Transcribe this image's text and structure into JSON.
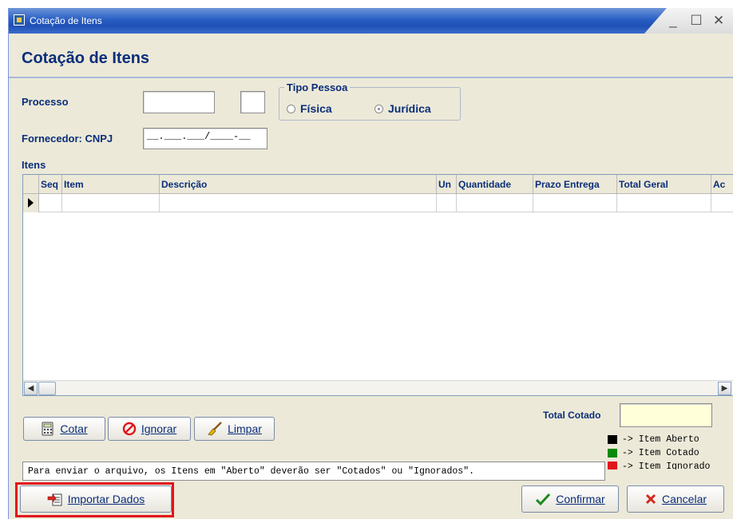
{
  "window": {
    "title": "Cotação de Itens",
    "minimize": "_",
    "maximize": "☐",
    "close": "✕"
  },
  "header": {
    "title": "Cotação de Itens"
  },
  "form": {
    "processo_label": "Processo",
    "processo_value": "",
    "processo_suffix_value": "",
    "fornecedor_label": "Fornecedor: CNPJ",
    "cnpj_mask": "__.___.___/____-__",
    "tipo_pessoa": {
      "legend": "Tipo Pessoa",
      "options": [
        "Física",
        "Jurídica"
      ],
      "selected": "Jurídica"
    }
  },
  "items": {
    "label": "Itens",
    "columns": [
      "Seq",
      "Item",
      "Descrição",
      "Un",
      "Quantidade",
      "Prazo Entrega",
      "Total Geral",
      "Ac"
    ],
    "rows": []
  },
  "total": {
    "label": "Total Cotado",
    "value": ""
  },
  "actions": {
    "cotar": "Cotar",
    "ignorar": "Ignorar",
    "limpar": "Limpar"
  },
  "note": "Para enviar o arquivo, os Itens em \"Aberto\" deverão ser \"Cotados\" ou \"Ignorados\".",
  "legend": [
    {
      "color": "#000000",
      "text": "-> Item Aberto"
    },
    {
      "color": "#0a8a0a",
      "text": "-> Item Cotado"
    },
    {
      "color": "#e2141c",
      "text": "-> Item Ignorado"
    }
  ],
  "footer": {
    "importar": "Importar Dados",
    "confirmar": "Confirmar",
    "cancelar": "Cancelar"
  }
}
